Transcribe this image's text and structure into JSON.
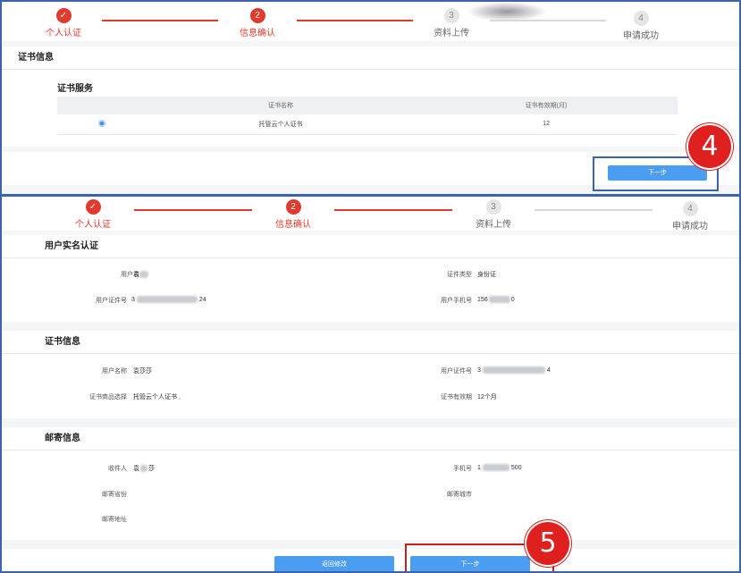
{
  "steps": [
    "个人认证",
    "信息确认",
    "资料上传",
    "申请成功"
  ],
  "step_numbers": [
    "2",
    "3",
    "4"
  ],
  "panel1": {
    "section_title": "证书信息",
    "sub_title": "证书服务",
    "table_headers": [
      "证书名称",
      "证书有效期(月)"
    ],
    "table_row": {
      "name": "托管云个人证书",
      "period": "12"
    },
    "next_label": "下一步",
    "badge": "4"
  },
  "panel2": {
    "realname_title": "用户实名认证",
    "realname": {
      "username_label": "用户名",
      "username_value": "袁",
      "idtype_label": "证件类型",
      "idtype_value": "身份证",
      "idno_label": "用户证件号",
      "idno_prefix": "3",
      "idno_suffix": "24",
      "phone_label": "用户手机号",
      "phone_prefix": "156",
      "phone_suffix": "0"
    },
    "cert_title": "证书信息",
    "cert": {
      "name_label": "用户名称",
      "name_value": "袁莎莎",
      "idno_label": "用户证件号",
      "idno_prefix": "3",
      "idno_suffix": "4",
      "product_label": "证书商品选择",
      "product_value": "托管云个人证书 ,",
      "period_label": "证书有效期",
      "period_value": "12个月"
    },
    "mail_title": "邮寄信息",
    "mail": {
      "receiver_label": "收件人",
      "receiver_prefix": "袁",
      "receiver_suffix": "莎",
      "phone_label": "手机号",
      "phone_prefix": "1",
      "phone_suffix": "500",
      "province_label": "邮寄省份",
      "city_label": "邮寄城市",
      "address_label": "邮寄地址"
    },
    "back_label": "返回修改",
    "next_label": "下一步",
    "badge": "5"
  },
  "colors": {
    "accent": "#e23b2e",
    "button": "#4b9df2",
    "frame": "#3b64ad",
    "badge": "#e0201e"
  }
}
